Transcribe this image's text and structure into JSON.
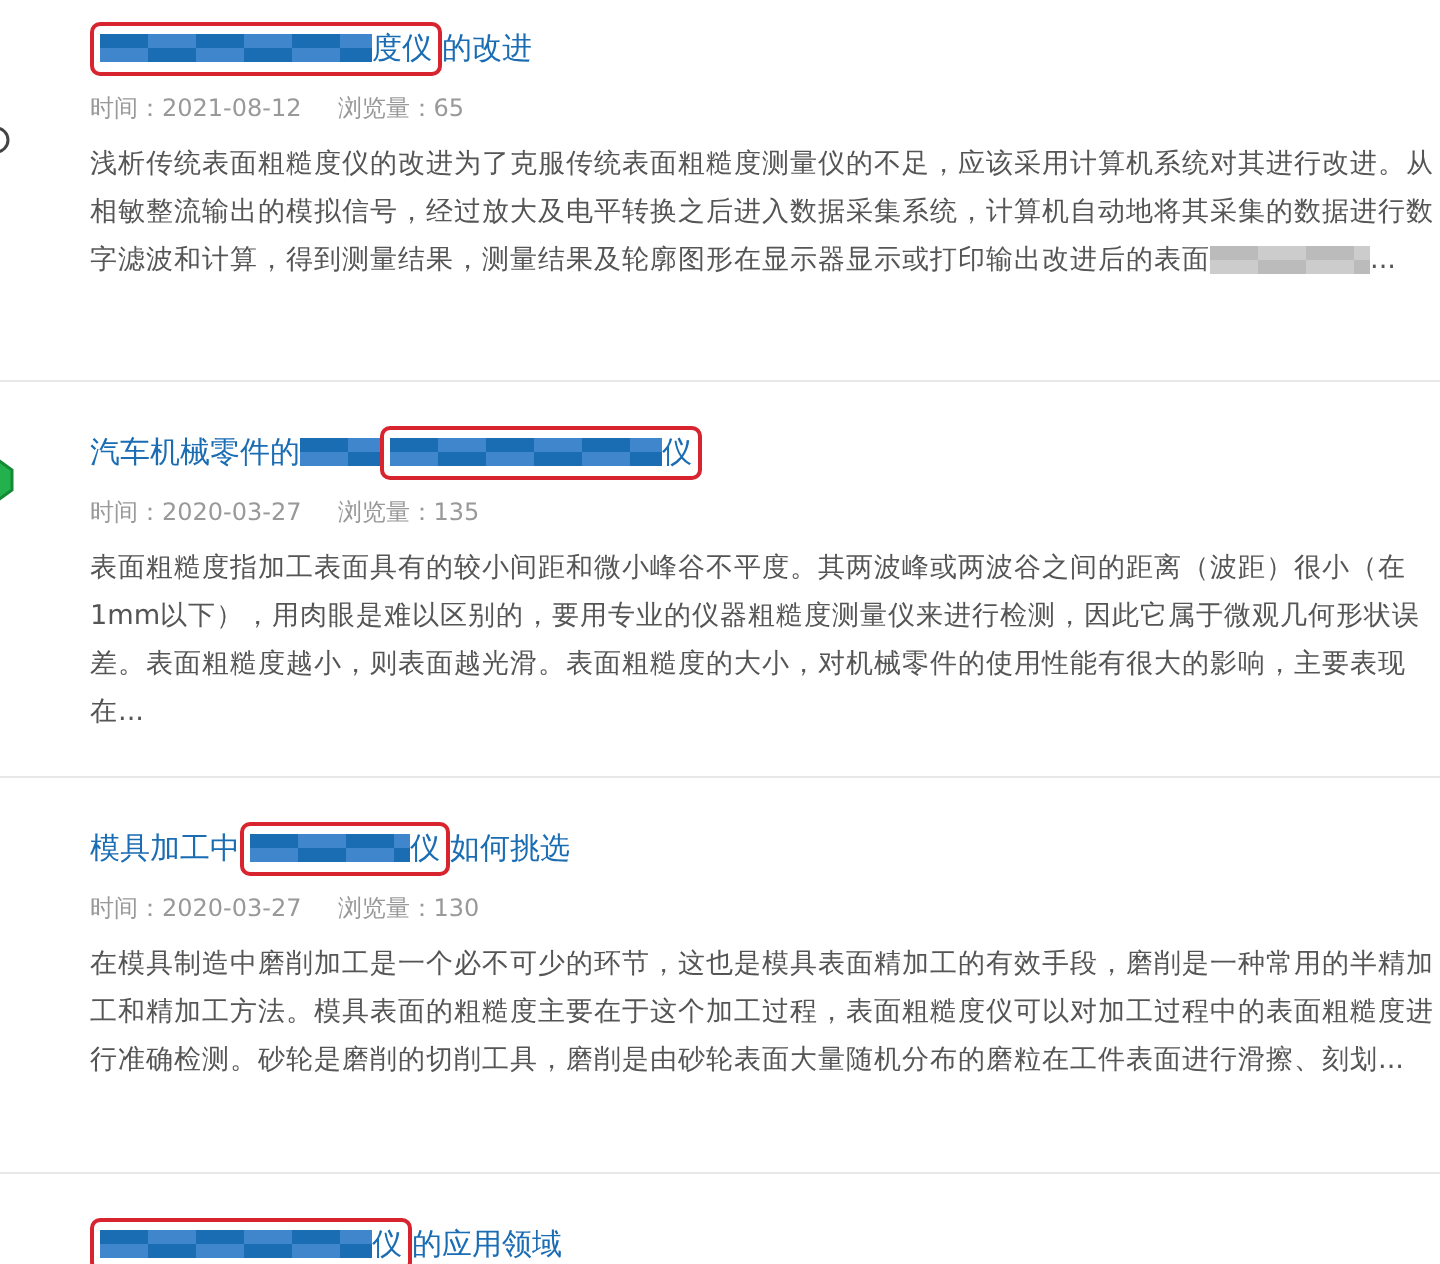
{
  "articles": [
    {
      "title": [
        {
          "kind": "highlight",
          "parts": [
            {
              "kind": "mosaic-long"
            },
            {
              "kind": "text",
              "text": "度仪"
            }
          ]
        },
        {
          "kind": "plain",
          "parts": [
            {
              "kind": "text",
              "text": "的改进"
            }
          ]
        }
      ],
      "time_label": "时间：2021-08-12",
      "views_label": "浏览量：65",
      "summary_lines": [
        [
          {
            "kind": "text",
            "text": "浅析传统表面粗糙度仪的改进为了克服传统表面粗糙度测量仪的不足，应该采用计算机系统对其进行改进。从"
          }
        ],
        [
          {
            "kind": "text",
            "text": "相敏整流输出的模拟信号，经过放大及电平转换之后进入数据采集系统，计算机自动地将其采集的数据进行数"
          }
        ],
        [
          {
            "kind": "text",
            "text": "字滤波和计算，得到测量结果，测量结果及轮廓图形在显示器显示或打印输出改进后的表面"
          },
          {
            "kind": "mosaic-medium"
          },
          {
            "kind": "text",
            "text": "..."
          }
        ]
      ]
    },
    {
      "title": [
        {
          "kind": "plain",
          "parts": [
            {
              "kind": "text",
              "text": "汽车机械零件的"
            },
            {
              "kind": "mosaic-short"
            }
          ]
        },
        {
          "kind": "highlight",
          "parts": [
            {
              "kind": "mosaic-long"
            },
            {
              "kind": "text",
              "text": "仪"
            }
          ]
        }
      ],
      "time_label": "时间：2020-03-27",
      "views_label": "浏览量：135",
      "summary_lines": [
        [
          {
            "kind": "text",
            "text": "表面粗糙度指加工表面具有的较小间距和微小峰谷不平度。其两波峰或两波谷之间的距离（波距）很小（在"
          }
        ],
        [
          {
            "kind": "text",
            "text": "1mm以下），用肉眼是难以区别的，要用专业的仪器粗糙度测量仪来进行检测，因此它属于微观几何形状误"
          }
        ],
        [
          {
            "kind": "text",
            "text": "差。表面粗糙度越小，则表面越光滑。表面粗糙度的大小，对机械零件的使用性能有很大的影响，主要表现"
          }
        ],
        [
          {
            "kind": "text",
            "text": "在..."
          }
        ]
      ]
    },
    {
      "title": [
        {
          "kind": "plain",
          "parts": [
            {
              "kind": "text",
              "text": "模具加工中"
            }
          ]
        },
        {
          "kind": "highlight",
          "parts": [
            {
              "kind": "mosaic-medium"
            },
            {
              "kind": "text",
              "text": "仪"
            }
          ]
        },
        {
          "kind": "plain",
          "parts": [
            {
              "kind": "text",
              "text": "如何挑选"
            }
          ]
        }
      ],
      "time_label": "时间：2020-03-27",
      "views_label": "浏览量：130",
      "summary_lines": [
        [
          {
            "kind": "text",
            "text": "在模具制造中磨削加工是一个必不可少的环节，这也是模具表面精加工的有效手段，磨削是一种常用的半精加"
          }
        ],
        [
          {
            "kind": "text",
            "text": "工和精加工方法。模具表面的粗糙度主要在于这个加工过程，表面粗糙度仪可以对加工过程中的表面粗糙度进"
          }
        ],
        [
          {
            "kind": "text",
            "text": "行准确检测。砂轮是磨削的切削工具，磨削是由砂轮表面大量随机分布的磨粒在工件表面进行滑擦、刻划..."
          }
        ]
      ]
    },
    {
      "title": [
        {
          "kind": "highlight",
          "parts": [
            {
              "kind": "mosaic-long"
            },
            {
              "kind": "text",
              "text": "仪"
            }
          ]
        },
        {
          "kind": "plain",
          "parts": [
            {
              "kind": "text",
              "text": "的应用领域"
            }
          ]
        }
      ]
    }
  ]
}
